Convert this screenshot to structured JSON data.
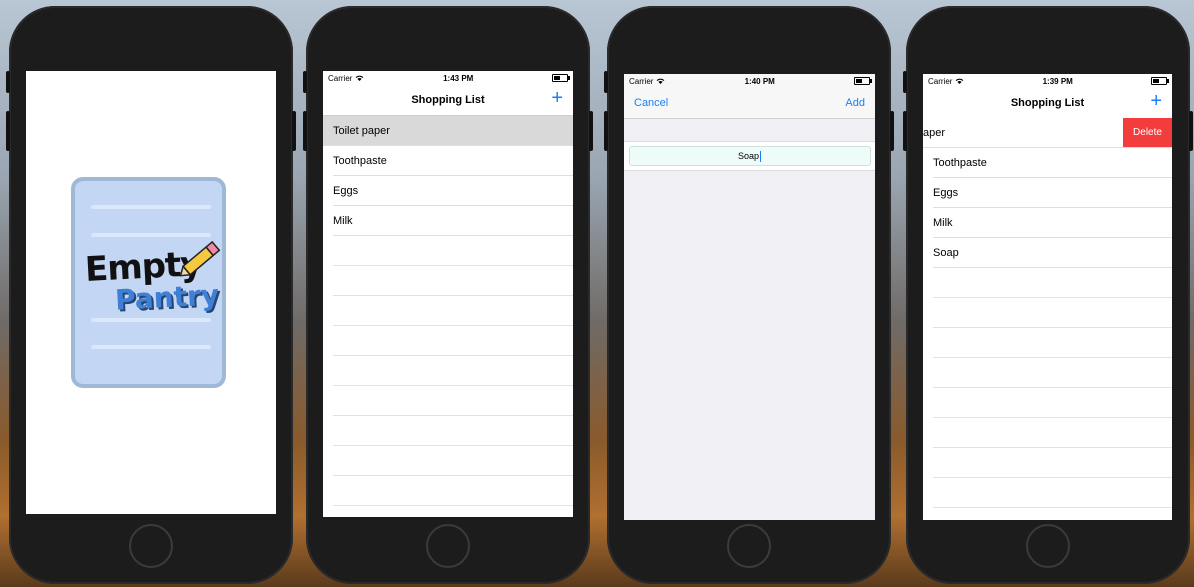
{
  "phone1": {
    "logo_top": "Empty",
    "logo_bottom": "Pantry"
  },
  "phone2": {
    "status": {
      "carrier": "Carrier",
      "time": "1:43 PM"
    },
    "title": "Shopping List",
    "add_icon": "+",
    "items": [
      "Toilet paper",
      "Toothpaste",
      "Eggs",
      "Milk"
    ]
  },
  "phone3": {
    "status": {
      "carrier": "Carrier",
      "time": "1:40 PM"
    },
    "cancel_label": "Cancel",
    "add_label": "Add",
    "input_value": "Soap"
  },
  "phone4": {
    "status": {
      "carrier": "Carrier",
      "time": "1:39 PM"
    },
    "title": "Shopping List",
    "add_icon": "+",
    "swiped_item": "aper",
    "delete_label": "Delete",
    "items": [
      "Toothpaste",
      "Eggs",
      "Milk",
      "Soap"
    ]
  },
  "colors": {
    "tint": "#1a7ef7",
    "delete": "#f33d3d",
    "logo_bg": "#c3d6f4"
  }
}
